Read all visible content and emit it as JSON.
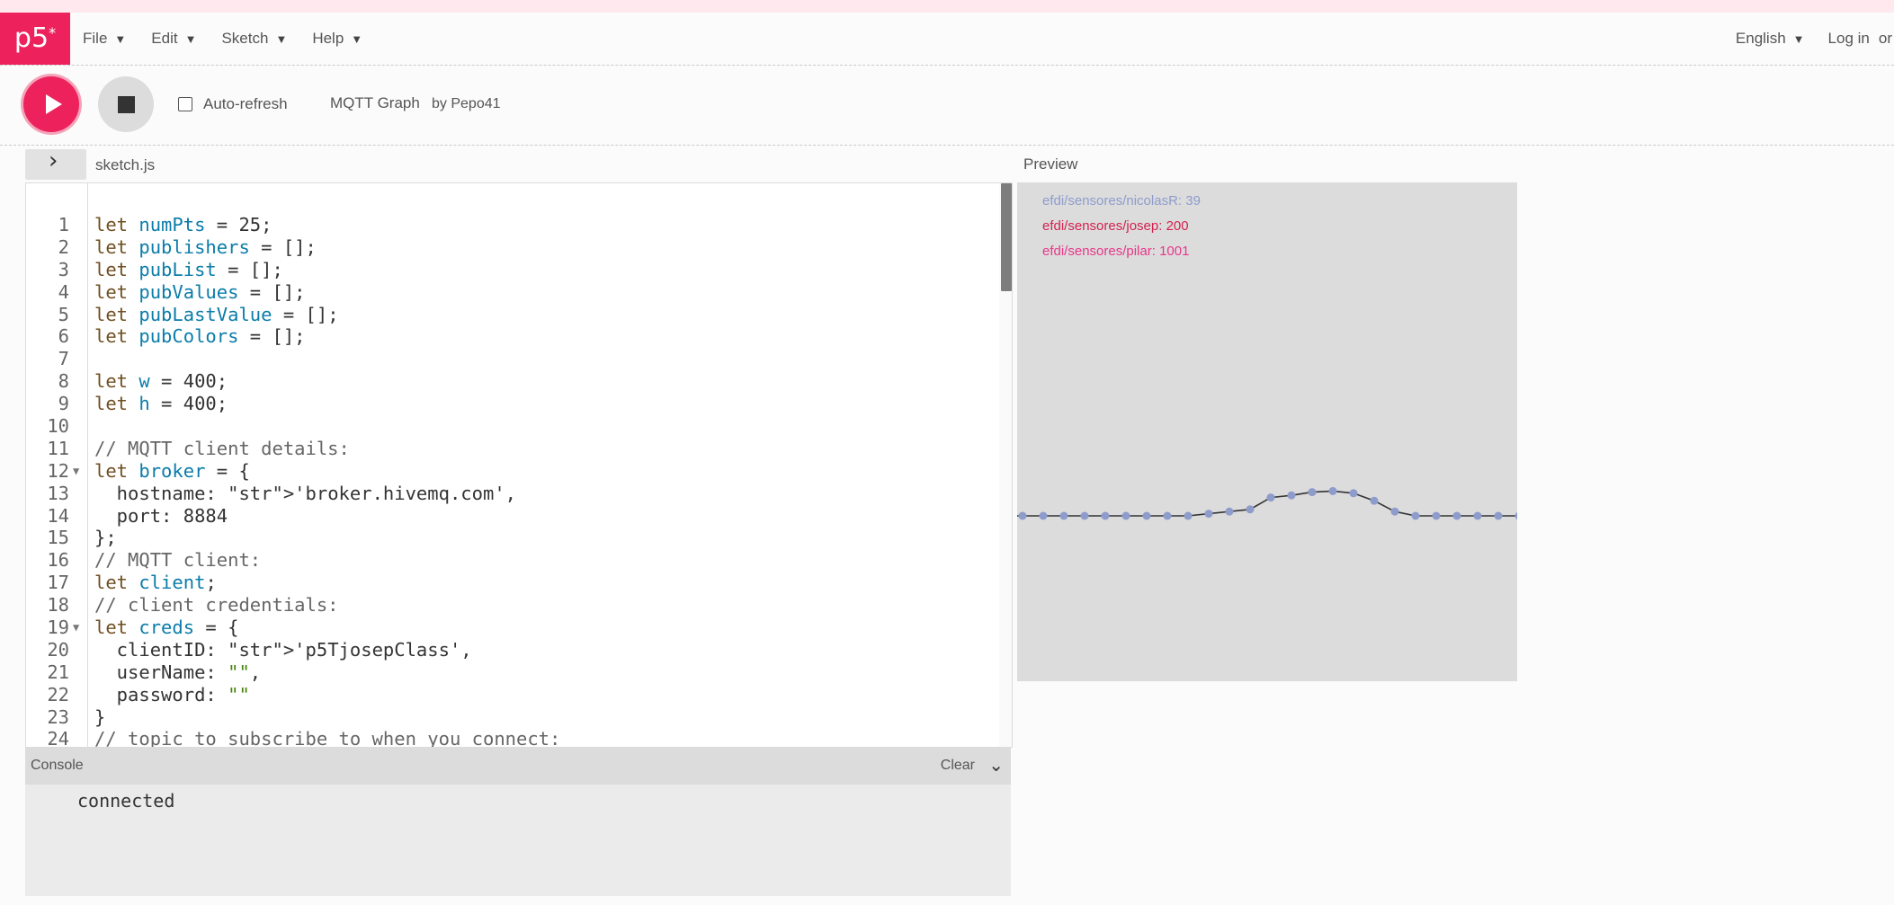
{
  "nav": {
    "logo": "p5",
    "logo_mark": "*",
    "menus": [
      {
        "label": "File"
      },
      {
        "label": "Edit"
      },
      {
        "label": "Sketch"
      },
      {
        "label": "Help"
      }
    ],
    "language": "English",
    "login": "Log in",
    "or": "or"
  },
  "toolbar": {
    "auto_refresh_label": "Auto-refresh",
    "auto_refresh_checked": false,
    "sketch_name": "MQTT Graph",
    "byline": "by Pepo41"
  },
  "editor": {
    "filename": "sketch.js",
    "lines": [
      "let numPts = 25;",
      "let publishers = [];",
      "let pubList = [];",
      "let pubValues = [];",
      "let pubLastValue = [];",
      "let pubColors = [];",
      "",
      "let w = 400;",
      "let h = 400;",
      "",
      "// MQTT client details:",
      "let broker = {",
      "  hostname: 'broker.hivemq.com',",
      "  port: 8884",
      "};",
      "// MQTT client:",
      "let client;",
      "// client credentials:",
      "let creds = {",
      "  clientID: 'p5TjosepClass',",
      "  userName: \"\",",
      "  password: \"\"",
      "}",
      "// topic to subscribe to when you connect:"
    ]
  },
  "console": {
    "title": "Console",
    "clear_label": "Clear",
    "messages": [
      "connected"
    ]
  },
  "preview": {
    "label": "Preview",
    "legend": [
      {
        "text": "efdi/sensores/nicolasR: 39",
        "color": "#8e9ccc"
      },
      {
        "text": "efdi/sensores/josep: 200",
        "color": "#d4214f"
      },
      {
        "text": "efdi/sensores/pilar: 1001",
        "color": "#e8378a"
      }
    ],
    "series_values": [
      0,
      0,
      0,
      0,
      0,
      0,
      0,
      0,
      0,
      0.2,
      0.4,
      0.6,
      1.7,
      1.9,
      2.2,
      2.3,
      2.1,
      1.4,
      0.4,
      0,
      0,
      0,
      0,
      0,
      0
    ],
    "point_color": "#8e9ccc",
    "line_color": "#333333"
  },
  "colors": {
    "accent": "#ed225d"
  }
}
